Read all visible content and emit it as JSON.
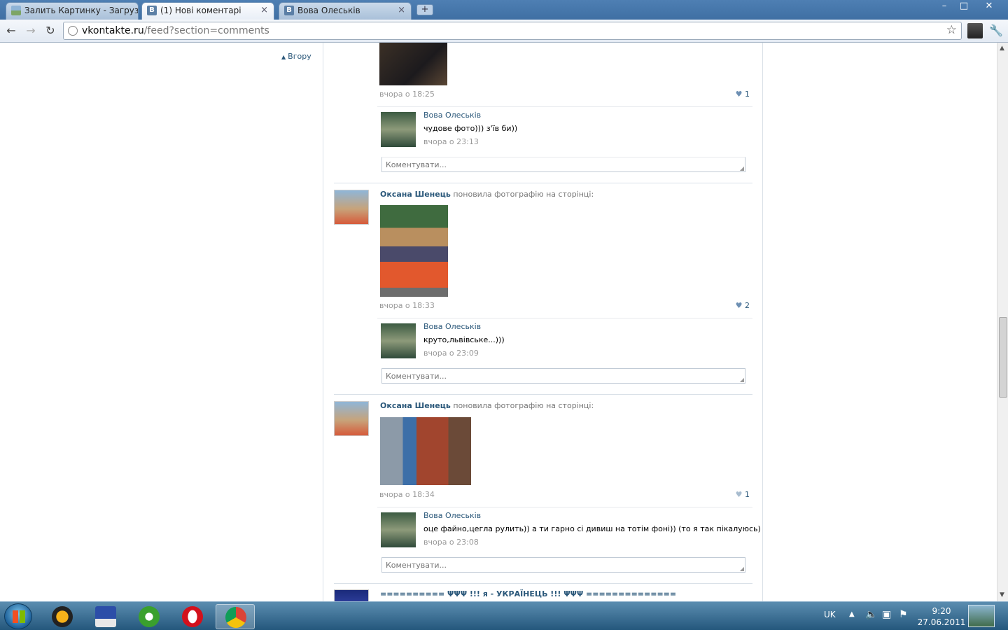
{
  "browser": {
    "tabs": [
      {
        "label": "Залить Картинку - Загрузи"
      },
      {
        "label": "(1) Нові коментарі"
      },
      {
        "label": "Вова Олеськів"
      }
    ],
    "favicon_letter": "B",
    "new_tab": "+",
    "close": "×",
    "url_host": "vkontakte.ru",
    "url_path": "/feed?section=comments",
    "window_controls": {
      "minimize": "–",
      "maximize": "□",
      "close": "✕"
    }
  },
  "page": {
    "up_link": "Вгору",
    "comment_placeholder": "Коментувати...",
    "posts": [
      {
        "date": "вчора о 18:25",
        "likes": "1",
        "reply": {
          "name": "Вова Олеськів",
          "text": "чудове фото))) з'їв би))",
          "date": "вчора о 23:13"
        }
      },
      {
        "author": "Оксана Шенець",
        "action": "поновила фотографію на сторінці:",
        "date": "вчора о 18:33",
        "likes": "2",
        "reply": {
          "name": "Вова Олеськів",
          "text": "круто,львівське...)))",
          "date": "вчора о 23:09"
        }
      },
      {
        "author": "Оксана Шенець",
        "action": "поновила фотографію на сторінці:",
        "date": "вчора о 18:34",
        "likes": "1",
        "reply": {
          "name": "Вова Олеськів",
          "text": "оце файно,цегла рулить)) а ти гарно сі дивиш на тотім фоні)) (то я так пікалуюсь)",
          "date": "вчора о 23:08"
        }
      },
      {
        "title": "========== ΨΨΨ !!! я - УКРАЇНЕЦЬ !!! ΨΨΨ =============="
      }
    ]
  },
  "taskbar": {
    "language": "UK",
    "time": "9:20",
    "date": "27.06.2011"
  },
  "colors": {
    "link": "#2b587a",
    "muted": "#999999",
    "divider": "#dae1e8"
  }
}
